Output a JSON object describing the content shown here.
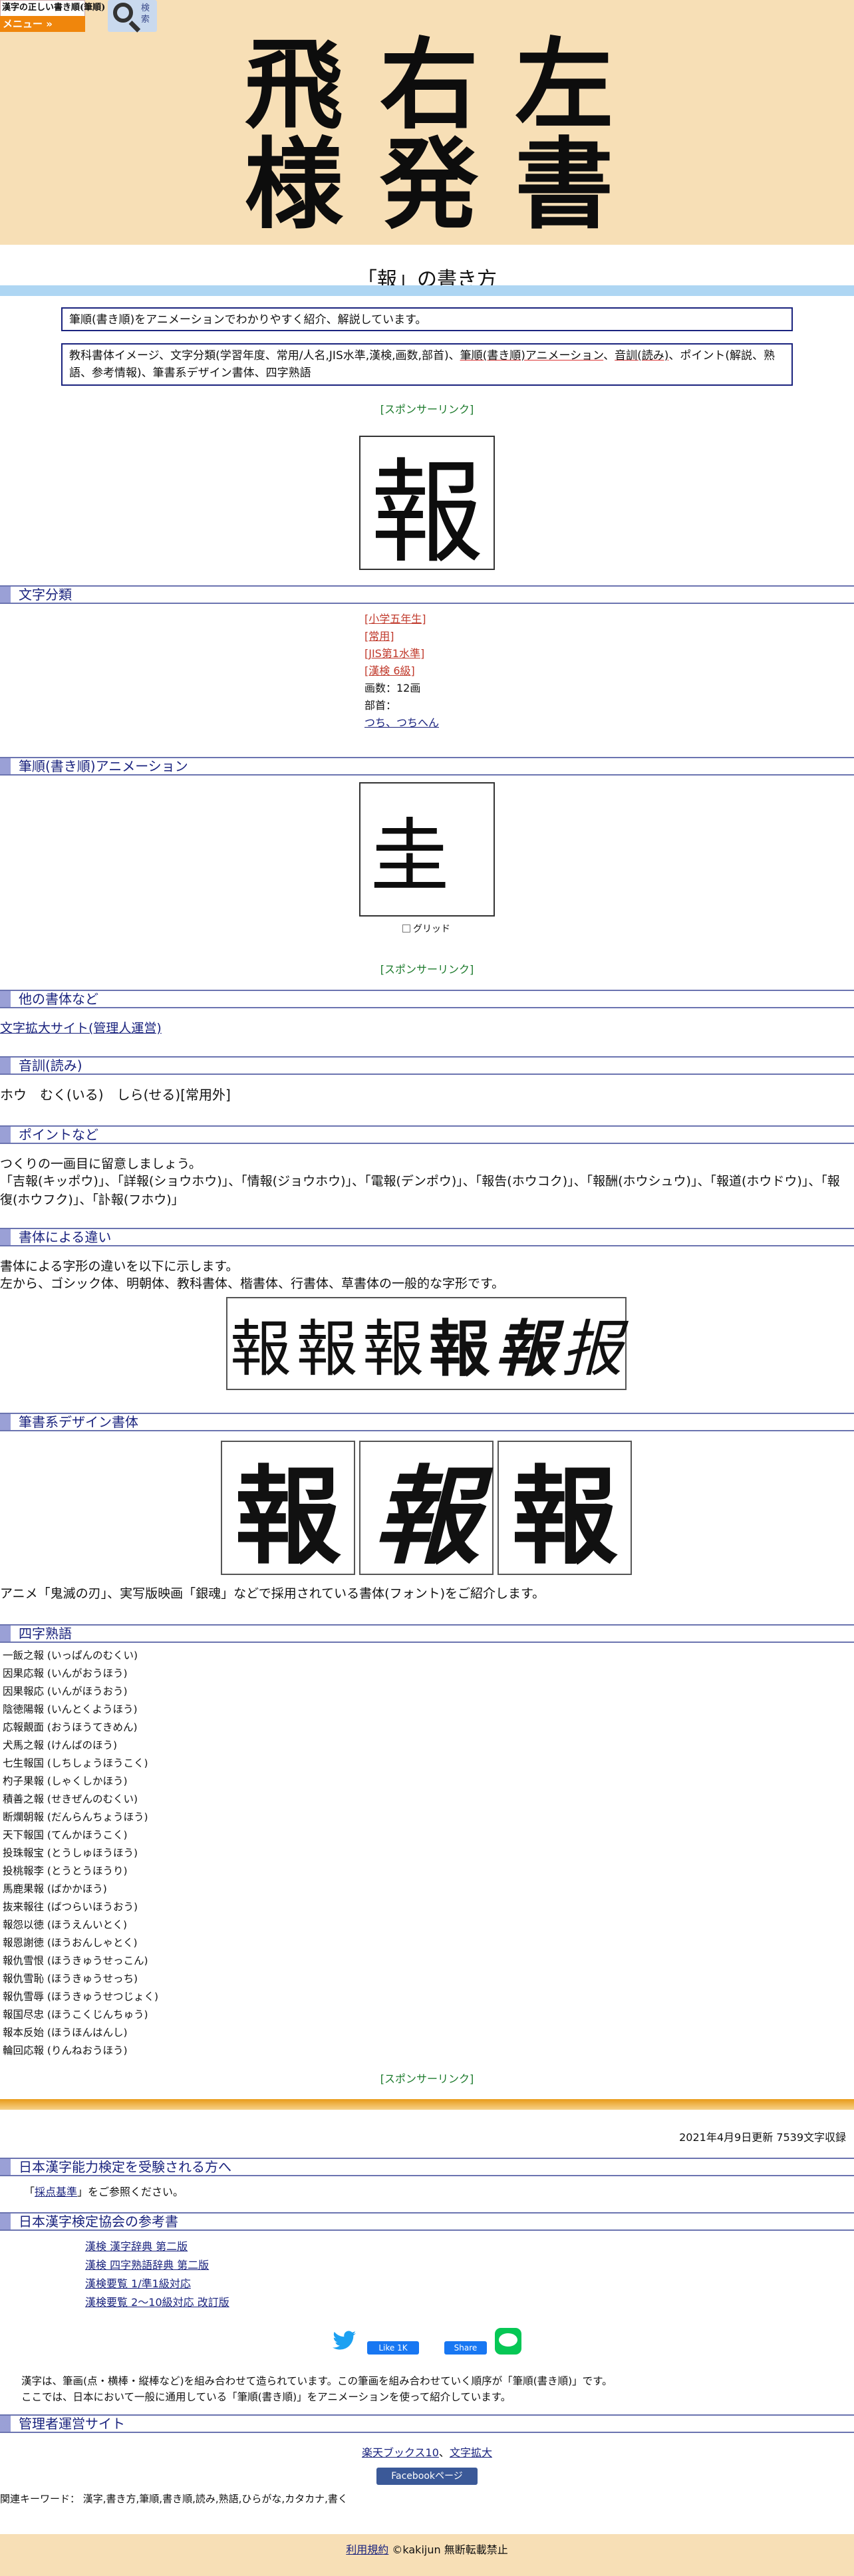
{
  "header": {
    "logo_text": "漢字の正しい書き順(筆順)",
    "menu_label": "メニュー »",
    "search_label": "検索",
    "banner": [
      "飛",
      "右",
      "左",
      "様",
      "発",
      "書"
    ]
  },
  "page_title": "「報」の書き方",
  "intro": {
    "line1": "筆順(書き順)をアニメーションでわかりやすく紹介、解説しています。",
    "line2_a": "教科書体イメージ、文字分類(学習年度、常用/人名,JIS水準,漢検,画数,部首)、",
    "line2_b": "筆順(書き順)アニメーション",
    "line2_c": "、",
    "line2_d": "音訓(読み)",
    "line2_e": "、ポイント(解説、熟語、参考情報)、筆書系デザイン書体、四字熟語"
  },
  "sponsor_label": "[スポンサーリンク]",
  "kanji": "報",
  "sections": {
    "classification": "文字分類",
    "animation": "筆順(書き順)アニメーション",
    "other_fonts": "他の書体など",
    "reading": "音訓(読み)",
    "points": "ポイントなど",
    "font_diff": "書体による違い",
    "design": "筆書系デザイン書体",
    "yoji": "四字熟語",
    "kentei": "日本漢字能力検定を受験される方へ",
    "books": "日本漢字検定協会の参考書",
    "admin": "管理者運営サイト"
  },
  "classification": {
    "grade": "[小学五年生]",
    "joyo": "[常用]",
    "jis": "[JIS第1水準]",
    "kanken": "[漢検 6級]",
    "strokes": "画数：12画",
    "bushu_label": "部首：",
    "bushu": "つち、つちへん"
  },
  "animation": {
    "current_frame": "圭",
    "grid_label": "グリッド"
  },
  "other_fonts_link": "文字拡大サイト(管理人運営)",
  "reading_text": "ホウ　むく(いる)　しら(せる)[常用外]",
  "points": {
    "line1": "つくりの一画目に留意しましょう。",
    "line2": "「吉報(キッポウ)」、「詳報(ショウホウ)」、「情報(ジョウホウ)」、「電報(デンポウ)」、「報告(ホウコク)」、「報酬(ホウシュウ)」、「報道(ホウドウ)」、「報復(ホウフク)」、「訃報(フホウ)」"
  },
  "font_diff": {
    "line1": "書体による字形の違いを以下に示します。",
    "line2": "左から、ゴシック体、明朝体、教科書体、楷書体、行書体、草書体の一般的な字形です。",
    "glyphs": [
      "報",
      "報",
      "報",
      "報",
      "報",
      "报"
    ]
  },
  "design": {
    "glyphs": [
      "報",
      "報",
      "報"
    ],
    "note": "アニメ「鬼滅の刃」、実写版映画「銀魂」などで採用されている書体(フォント)をご紹介します。"
  },
  "yoji": [
    "一飯之報 (いっぱんのむくい)",
    "因果応報 (いんがおうほう)",
    "因果報応 (いんがほうおう)",
    "陰徳陽報 (いんとくようほう)",
    "応報覿面 (おうほうてきめん)",
    "犬馬之報 (けんばのほう)",
    "七生報国 (しちしょうほうこく)",
    "杓子果報 (しゃくしかほう)",
    "積善之報 (せきぜんのむくい)",
    "断爛朝報 (だんらんちょうほう)",
    "天下報国 (てんかほうこく)",
    "投珠報宝 (とうしゅほうほう)",
    "投桃報李 (とうとうほうり)",
    "馬鹿果報 (ばかかほう)",
    "抜来報往 (ばつらいほうおう)",
    "報怨以徳 (ほうえんいとく)",
    "報恩謝徳 (ほうおんしゃとく)",
    "報仇雪恨 (ほうきゅうせっこん)",
    "報仇雪恥 (ほうきゅうせっち)",
    "報仇雪辱 (ほうきゅうせつじょく)",
    "報国尽忠 (ほうこくじんちゅう)",
    "報本反始 (ほうほんはんし)",
    "輪回応報 (りんねおうほう)"
  ],
  "update_line": "2021年4月9日更新 7539文字収録",
  "kentei": {
    "pre": "「",
    "link": "採点基準",
    "post": "」をご参照ください。"
  },
  "books": [
    "漢検 漢字辞典 第二版",
    "漢検 四字熟語辞典 第二版",
    "漢検要覧 1/準1級対応",
    "漢検要覧 2〜10級対応 改訂版"
  ],
  "social": {
    "like": "Like 1K",
    "share": "Share"
  },
  "explanation": {
    "line1": "漢字は、筆画(点・横棒・縦棒など)を組み合わせて造られています。この筆画を組み合わせていく順序が「筆順(書き順)」です。",
    "line2": "ここでは、日本において一般に通用している「筆順(書き順)」をアニメーションを使って紹介しています。"
  },
  "admin_links": [
    "楽天ブックス10",
    "文字拡大"
  ],
  "facebook_label": "Facebookページ",
  "keywords": "関連キーワード： 漢字,書き方,筆順,書き順,読み,熟語,ひらがな,カタカナ,書く",
  "footer": {
    "terms": "利用規約",
    "copyright": "©kakijun 無断転載禁止"
  },
  "colors": {
    "header_bg": "#f7dfb6",
    "menu_orange": "#f0860c",
    "section_blue": "#1a237e",
    "sponsor_green": "#1b7a2b"
  }
}
